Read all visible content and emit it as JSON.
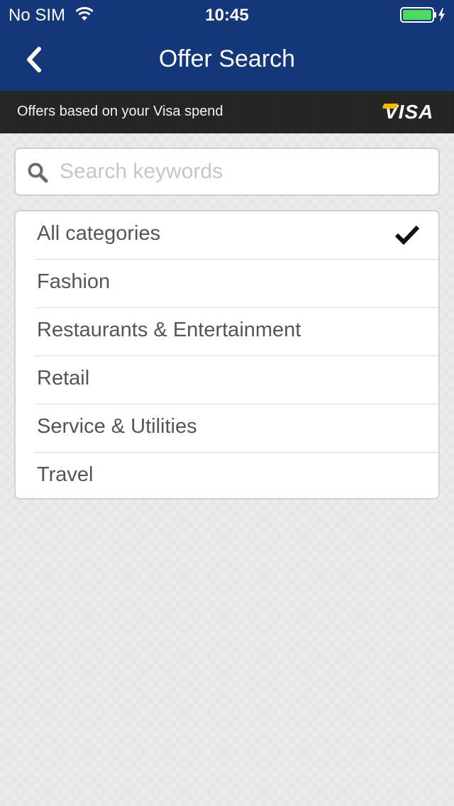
{
  "status_bar": {
    "carrier": "No SIM",
    "time": "10:45",
    "wifi_icon": "wifi-icon",
    "battery_icon": "battery-icon"
  },
  "nav": {
    "title": "Offer Search",
    "back_icon": "chevron-left-icon",
    "background_color": "#14377a"
  },
  "banner": {
    "text": "Offers based on your Visa spend",
    "logo": "VISA",
    "logo_accent_color": "#f7b600"
  },
  "search": {
    "placeholder": "Search keywords",
    "value": "",
    "icon": "search-icon"
  },
  "categories": {
    "items": [
      {
        "label": "All categories",
        "selected": true
      },
      {
        "label": "Fashion",
        "selected": false
      },
      {
        "label": "Restaurants & Entertainment",
        "selected": false
      },
      {
        "label": "Retail",
        "selected": false
      },
      {
        "label": "Service & Utilities",
        "selected": false
      },
      {
        "label": "Travel",
        "selected": false
      }
    ],
    "selected_icon": "checkmark-icon"
  }
}
